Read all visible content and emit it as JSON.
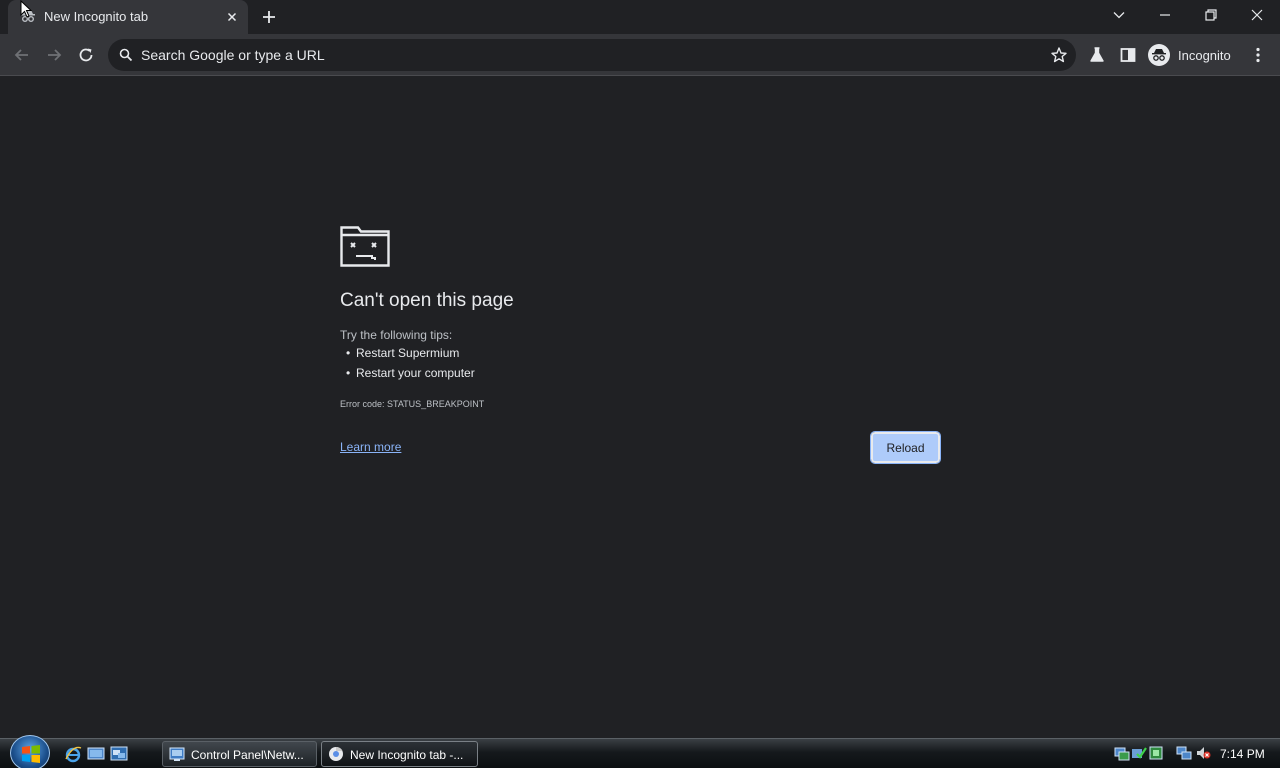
{
  "tab": {
    "title": "New Incognito tab",
    "favicon": "incognito-icon"
  },
  "omnibox": {
    "placeholder": "Search Google or type a URL"
  },
  "profile": {
    "label": "Incognito"
  },
  "error_page": {
    "title": "Can't open this page",
    "tips_heading": "Try the following tips:",
    "tips": [
      "Restart Supermium",
      "Restart your computer"
    ],
    "error_code": "Error code: STATUS_BREAKPOINT",
    "learn_more": "Learn more",
    "reload": "Reload"
  },
  "taskbar": {
    "buttons": [
      {
        "label": "Control Panel\\Netw...",
        "icon": "control-panel-icon"
      },
      {
        "label": "New Incognito tab -...",
        "icon": "browser-icon"
      }
    ],
    "clock": "7:14 PM"
  },
  "colors": {
    "background": "#202124",
    "toolbar": "#35363a",
    "link": "#8ab4f8",
    "button": "#aecbfa"
  }
}
